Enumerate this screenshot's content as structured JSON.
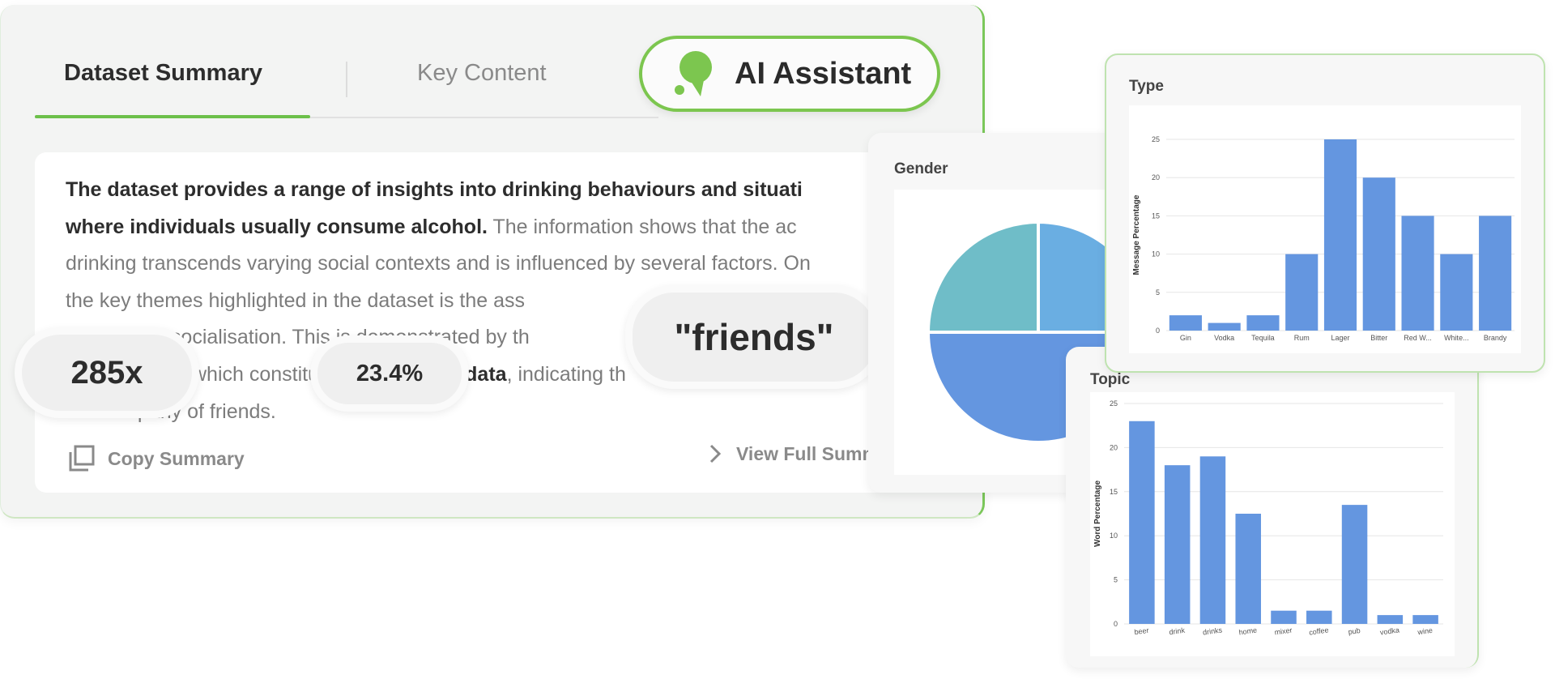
{
  "tabs": [
    {
      "label": "Dataset Summary"
    },
    {
      "label": "Key Content"
    }
  ],
  "ai_button": {
    "label": "AI Assistant"
  },
  "summary": {
    "line1_bold": "The dataset provides a range of insights into drinking behaviours and situati",
    "line2_bold": "where individuals usually consume alcohol.",
    "line2_rest": " The information shows that the ac",
    "line3": "drinking transcends varying social contexts and is influenced by several factors. On",
    "line4": "the key themes highlighted in the dataset is the ass",
    "line5": "tion and socialisation. This is demonstrated by th",
    "line6_pre": "which constitu",
    "line6_bold": "he data",
    "line6_rest": ", indicating th",
    "line7": "the company of friends."
  },
  "actions": {
    "copy": "Copy Summary",
    "view": "View Full Summ"
  },
  "bubbles": {
    "count": "285x",
    "percent": "23.4%",
    "keyword": "\"friends\""
  },
  "colors": {
    "accent_green": "#6cc04a",
    "bar_blue": "#6496e0",
    "pie_blue": "#6496e0",
    "pie_light_blue": "#6aaee2",
    "pie_teal": "#6fbdc8"
  },
  "chart_data": [
    {
      "type": "pie",
      "title": "Gender",
      "slices": [
        {
          "value": 25,
          "color": "#6fbdc8"
        },
        {
          "value": 25,
          "color": "#6aaee2"
        },
        {
          "value": 50,
          "color": "#6496e0"
        }
      ]
    },
    {
      "type": "bar",
      "title": "Type",
      "ylabel": "Message Percentage",
      "ylim": [
        0,
        25
      ],
      "yticks": [
        "0",
        "5",
        "10",
        "15",
        "20",
        "25"
      ],
      "categories": [
        "Gin",
        "Vodka",
        "Tequila",
        "Rum",
        "Lager",
        "Bitter",
        "Red W...",
        "White...",
        "Brandy"
      ],
      "values": [
        2,
        1,
        2,
        10,
        25,
        20,
        15,
        10,
        15
      ]
    },
    {
      "type": "bar",
      "title": "Topic",
      "ylabel": "Word Percentage",
      "ylim": [
        0,
        25
      ],
      "yticks": [
        "0",
        "5",
        "10",
        "15",
        "20",
        "25"
      ],
      "categories": [
        "beer",
        "drink",
        "drinks",
        "home",
        "mixer",
        "coffee",
        "pub",
        "vodka",
        "wine"
      ],
      "values": [
        23,
        18,
        19,
        12.5,
        1.5,
        1.5,
        13.5,
        1,
        1
      ]
    }
  ]
}
